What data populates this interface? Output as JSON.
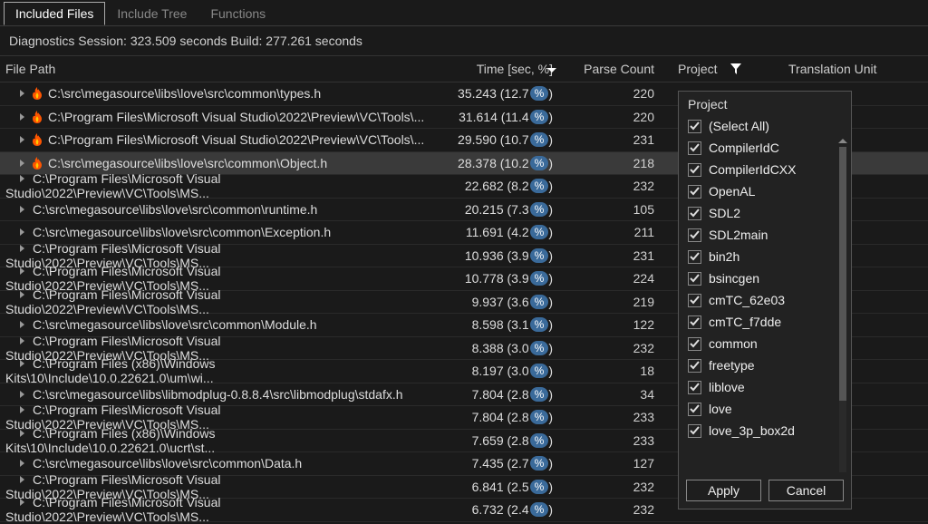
{
  "tabs": [
    "Included Files",
    "Include Tree",
    "Functions"
  ],
  "activeTab": 0,
  "status": "Diagnostics Session: 323.509 seconds  Build: 277.261 seconds",
  "columns": {
    "path": "File Path",
    "time": "Time [sec, %]",
    "parse": "Parse Count",
    "project": "Project",
    "tu": "Translation Unit"
  },
  "rows": [
    {
      "fire": true,
      "path": "C:\\src\\megasource\\libs\\love\\src\\common\\types.h",
      "sec": "35.243",
      "pct": "12.7",
      "parse": "220",
      "sel": false
    },
    {
      "fire": true,
      "path": "C:\\Program Files\\Microsoft Visual Studio\\2022\\Preview\\VC\\Tools\\...",
      "sec": "31.614",
      "pct": "11.4",
      "parse": "220",
      "sel": false
    },
    {
      "fire": true,
      "path": "C:\\Program Files\\Microsoft Visual Studio\\2022\\Preview\\VC\\Tools\\...",
      "sec": "29.590",
      "pct": "10.7",
      "parse": "231",
      "sel": false
    },
    {
      "fire": true,
      "path": "C:\\src\\megasource\\libs\\love\\src\\common\\Object.h",
      "sec": "28.378",
      "pct": "10.2",
      "parse": "218",
      "sel": true
    },
    {
      "fire": false,
      "path": "C:\\Program Files\\Microsoft Visual Studio\\2022\\Preview\\VC\\Tools\\MS...",
      "sec": "22.682",
      "pct": "8.2",
      "parse": "232",
      "sel": false
    },
    {
      "fire": false,
      "path": "C:\\src\\megasource\\libs\\love\\src\\common\\runtime.h",
      "sec": "20.215",
      "pct": "7.3",
      "parse": "105",
      "sel": false
    },
    {
      "fire": false,
      "path": "C:\\src\\megasource\\libs\\love\\src\\common\\Exception.h",
      "sec": "11.691",
      "pct": "4.2",
      "parse": "211",
      "sel": false
    },
    {
      "fire": false,
      "path": "C:\\Program Files\\Microsoft Visual Studio\\2022\\Preview\\VC\\Tools\\MS...",
      "sec": "10.936",
      "pct": "3.9",
      "parse": "231",
      "sel": false
    },
    {
      "fire": false,
      "path": "C:\\Program Files\\Microsoft Visual Studio\\2022\\Preview\\VC\\Tools\\MS...",
      "sec": "10.778",
      "pct": "3.9",
      "parse": "224",
      "sel": false
    },
    {
      "fire": false,
      "path": "C:\\Program Files\\Microsoft Visual Studio\\2022\\Preview\\VC\\Tools\\MS...",
      "sec": "9.937",
      "pct": "3.6",
      "parse": "219",
      "sel": false
    },
    {
      "fire": false,
      "path": "C:\\src\\megasource\\libs\\love\\src\\common\\Module.h",
      "sec": "8.598",
      "pct": "3.1",
      "parse": "122",
      "sel": false
    },
    {
      "fire": false,
      "path": "C:\\Program Files\\Microsoft Visual Studio\\2022\\Preview\\VC\\Tools\\MS...",
      "sec": "8.388",
      "pct": "3.0",
      "parse": "232",
      "sel": false
    },
    {
      "fire": false,
      "path": "C:\\Program Files (x86)\\Windows Kits\\10\\Include\\10.0.22621.0\\um\\wi...",
      "sec": "8.197",
      "pct": "3.0",
      "parse": "18",
      "sel": false
    },
    {
      "fire": false,
      "path": "C:\\src\\megasource\\libs\\libmodplug-0.8.8.4\\src\\libmodplug\\stdafx.h",
      "sec": "7.804",
      "pct": "2.8",
      "parse": "34",
      "sel": false
    },
    {
      "fire": false,
      "path": "C:\\Program Files\\Microsoft Visual Studio\\2022\\Preview\\VC\\Tools\\MS...",
      "sec": "7.804",
      "pct": "2.8",
      "parse": "233",
      "sel": false
    },
    {
      "fire": false,
      "path": "C:\\Program Files (x86)\\Windows Kits\\10\\Include\\10.0.22621.0\\ucrt\\st...",
      "sec": "7.659",
      "pct": "2.8",
      "parse": "233",
      "sel": false
    },
    {
      "fire": false,
      "path": "C:\\src\\megasource\\libs\\love\\src\\common\\Data.h",
      "sec": "7.435",
      "pct": "2.7",
      "parse": "127",
      "sel": false
    },
    {
      "fire": false,
      "path": "C:\\Program Files\\Microsoft Visual Studio\\2022\\Preview\\VC\\Tools\\MS...",
      "sec": "6.841",
      "pct": "2.5",
      "parse": "232",
      "sel": false
    },
    {
      "fire": false,
      "path": "C:\\Program Files\\Microsoft Visual Studio\\2022\\Preview\\VC\\Tools\\MS...",
      "sec": "6.732",
      "pct": "2.4",
      "parse": "232",
      "sel": false
    }
  ],
  "filterDropdown": {
    "title": "Project",
    "items": [
      "(Select All)",
      "CompilerIdC",
      "CompilerIdCXX",
      "OpenAL",
      "SDL2",
      "SDL2main",
      "bin2h",
      "bsincgen",
      "cmTC_62e03",
      "cmTC_f7dde",
      "common",
      "freetype",
      "liblove",
      "love",
      "love_3p_box2d"
    ],
    "apply": "Apply",
    "cancel": "Cancel"
  }
}
